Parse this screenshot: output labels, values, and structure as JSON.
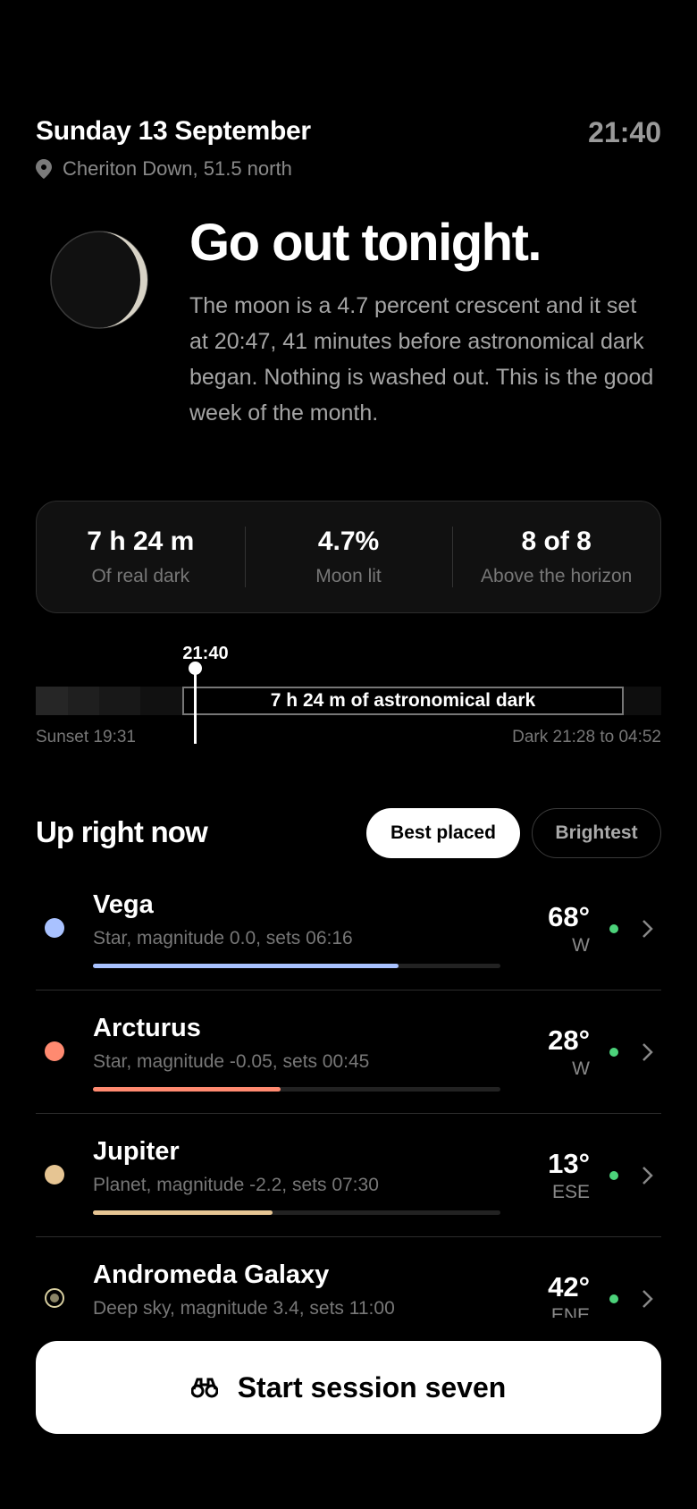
{
  "header": {
    "date": "Sunday 13 September",
    "time": "21:40",
    "location": "Cheriton Down, 51.5 north"
  },
  "hero": {
    "title": "Go out tonight.",
    "text": "The moon is a 4.7 percent crescent and it set at 20:47, 41 minutes before astronomical dark began. Nothing is washed out. This is the good week of the month."
  },
  "stats": [
    {
      "value": "7 h 24 m",
      "label": "Of real dark"
    },
    {
      "value": "4.7%",
      "label": "Moon lit"
    },
    {
      "value": "8 of 8",
      "label": "Above the horizon"
    }
  ],
  "timeline": {
    "now": "21:40",
    "dark_label": "7 h 24 m of astronomical dark",
    "sunset": "Sunset 19:31",
    "dark_range": "Dark 21:28 to 04:52"
  },
  "section": {
    "title": "Up right now",
    "filters": [
      "Best placed",
      "Brightest"
    ],
    "active_filter": "Best placed"
  },
  "objects": [
    {
      "name": "Vega",
      "detail": "Star, magnitude 0.0, sets 06:16",
      "altitude": "68°",
      "direction": "W",
      "color": "#a9c2ff",
      "fill": 0.75
    },
    {
      "name": "Arcturus",
      "detail": "Star, magnitude -0.05, sets 00:45",
      "altitude": "28°",
      "direction": "W",
      "color": "#ff8a70",
      "fill": 0.46
    },
    {
      "name": "Jupiter",
      "detail": "Planet, magnitude -2.2, sets 07:30",
      "altitude": "13°",
      "direction": "ESE",
      "color": "#e6c593",
      "fill": 0.44
    },
    {
      "name": "Andromeda Galaxy",
      "detail": "Deep sky, magnitude 3.4, sets 11:00",
      "altitude": "42°",
      "direction": "ENE",
      "color": "#d8cfa0",
      "fill": 0.3
    }
  ],
  "cta": {
    "label": "Start session seven",
    "icon": "binoculars-icon"
  },
  "colors": {
    "status_green": "#4cd27a",
    "accent_gray": "#9a9a9a"
  }
}
